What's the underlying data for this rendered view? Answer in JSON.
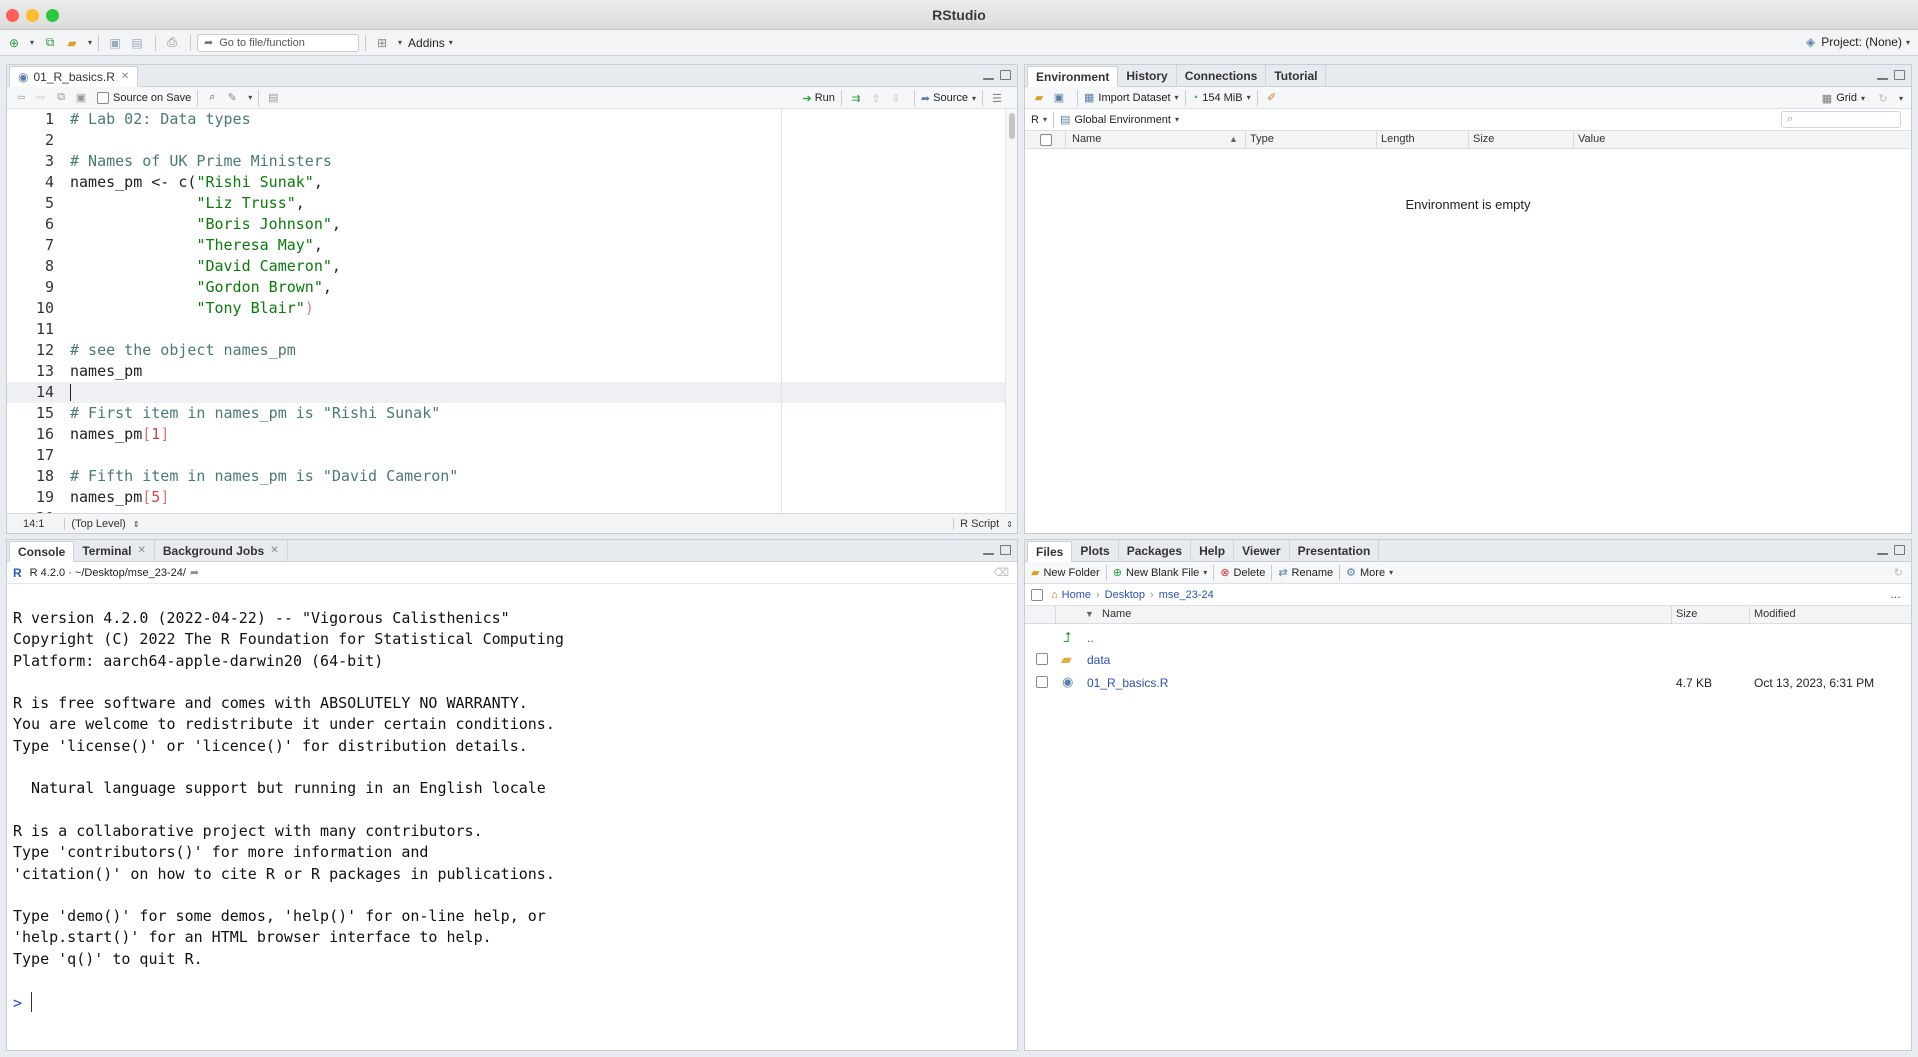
{
  "window": {
    "title": "RStudio"
  },
  "toolbar": {
    "goto_placeholder": "Go to file/function",
    "addins_label": "Addins",
    "project_label": "Project: (None)"
  },
  "editor": {
    "tab_label": "01_R_basics.R",
    "source_on_save": "Source on Save",
    "run_label": "Run",
    "source_label": "Source",
    "status_position": "14:1",
    "status_scope": "(Top Level)",
    "status_filetype": "R Script",
    "lines": [
      {
        "n": "1",
        "parts": [
          [
            "cm",
            "# Lab 02: Data types"
          ]
        ]
      },
      {
        "n": "2",
        "parts": []
      },
      {
        "n": "3",
        "parts": [
          [
            "cm",
            "# Names of UK Prime Ministers"
          ]
        ]
      },
      {
        "n": "4",
        "parts": [
          [
            "",
            "names_pm <- c("
          ],
          [
            "str",
            "\"Rishi Sunak\""
          ],
          [
            "",
            ","
          ]
        ]
      },
      {
        "n": "5",
        "parts": [
          [
            "",
            "              "
          ],
          [
            "str",
            "\"Liz Truss\""
          ],
          [
            "",
            ","
          ]
        ]
      },
      {
        "n": "6",
        "parts": [
          [
            "",
            "              "
          ],
          [
            "str",
            "\"Boris Johnson\""
          ],
          [
            "",
            ","
          ]
        ]
      },
      {
        "n": "7",
        "parts": [
          [
            "",
            "              "
          ],
          [
            "str",
            "\"Theresa May\""
          ],
          [
            "",
            ","
          ]
        ]
      },
      {
        "n": "8",
        "parts": [
          [
            "",
            "              "
          ],
          [
            "str",
            "\"David Cameron\""
          ],
          [
            "",
            ","
          ]
        ]
      },
      {
        "n": "9",
        "parts": [
          [
            "",
            "              "
          ],
          [
            "str",
            "\"Gordon Brown\""
          ],
          [
            "",
            ","
          ]
        ]
      },
      {
        "n": "10",
        "parts": [
          [
            "",
            "              "
          ],
          [
            "str",
            "\"Tony Blair\""
          ],
          [
            "par",
            ")"
          ]
        ]
      },
      {
        "n": "11",
        "parts": []
      },
      {
        "n": "12",
        "parts": [
          [
            "cm",
            "# see the object names_pm"
          ]
        ]
      },
      {
        "n": "13",
        "parts": [
          [
            "",
            "names_pm"
          ]
        ]
      },
      {
        "n": "14",
        "parts": [],
        "current": true
      },
      {
        "n": "15",
        "parts": [
          [
            "cm",
            "# First item in names_pm is \"Rishi Sunak\""
          ]
        ]
      },
      {
        "n": "16",
        "parts": [
          [
            "",
            "names_pm"
          ],
          [
            "par",
            "["
          ],
          [
            "num",
            "1"
          ],
          [
            "par",
            "]"
          ]
        ]
      },
      {
        "n": "17",
        "parts": []
      },
      {
        "n": "18",
        "parts": [
          [
            "cm",
            "# Fifth item in names_pm is \"David Cameron\""
          ]
        ]
      },
      {
        "n": "19",
        "parts": [
          [
            "",
            "names_pm"
          ],
          [
            "par",
            "["
          ],
          [
            "num",
            "5"
          ],
          [
            "par",
            "]"
          ]
        ]
      },
      {
        "n": "20",
        "parts": []
      }
    ]
  },
  "console": {
    "tabs": [
      "Console",
      "Terminal",
      "Background Jobs"
    ],
    "path": "R 4.2.0 · ~/Desktop/mse_23-24/",
    "output": "R version 4.2.0 (2022-04-22) -- \"Vigorous Calisthenics\"\nCopyright (C) 2022 The R Foundation for Statistical Computing\nPlatform: aarch64-apple-darwin20 (64-bit)\n\nR is free software and comes with ABSOLUTELY NO WARRANTY.\nYou are welcome to redistribute it under certain conditions.\nType 'license()' or 'licence()' for distribution details.\n\n  Natural language support but running in an English locale\n\nR is a collaborative project with many contributors.\nType 'contributors()' for more information and\n'citation()' on how to cite R or R packages in publications.\n\nType 'demo()' for some demos, 'help()' for on-line help, or\n'help.start()' for an HTML browser interface to help.\nType 'q()' to quit R.",
    "prompt": ">"
  },
  "environment": {
    "tabs": [
      "Environment",
      "History",
      "Connections",
      "Tutorial"
    ],
    "import_dataset": "Import Dataset",
    "memory": "154 MiB",
    "view_mode": "Grid",
    "language": "R",
    "scope": "Global Environment",
    "columns": [
      "Name",
      "Type",
      "Length",
      "Size",
      "Value"
    ],
    "empty_message": "Environment is empty"
  },
  "files": {
    "tabs": [
      "Files",
      "Plots",
      "Packages",
      "Help",
      "Viewer",
      "Presentation"
    ],
    "new_folder": "New Folder",
    "new_blank_file": "New Blank File",
    "delete": "Delete",
    "rename": "Rename",
    "more": "More",
    "breadcrumb": [
      "Home",
      "Desktop",
      "mse_23-24"
    ],
    "columns": [
      "Name",
      "Size",
      "Modified"
    ],
    "parent": "..",
    "rows": [
      {
        "name": "data",
        "size": "",
        "modified": ""
      },
      {
        "name": "01_R_basics.R",
        "size": "4.7 KB",
        "modified": "Oct 13, 2023, 6:31 PM"
      }
    ]
  },
  "colors": {
    "accent": "#2a52b3",
    "comment": "#4a7a77",
    "string": "#0b7a0b"
  }
}
